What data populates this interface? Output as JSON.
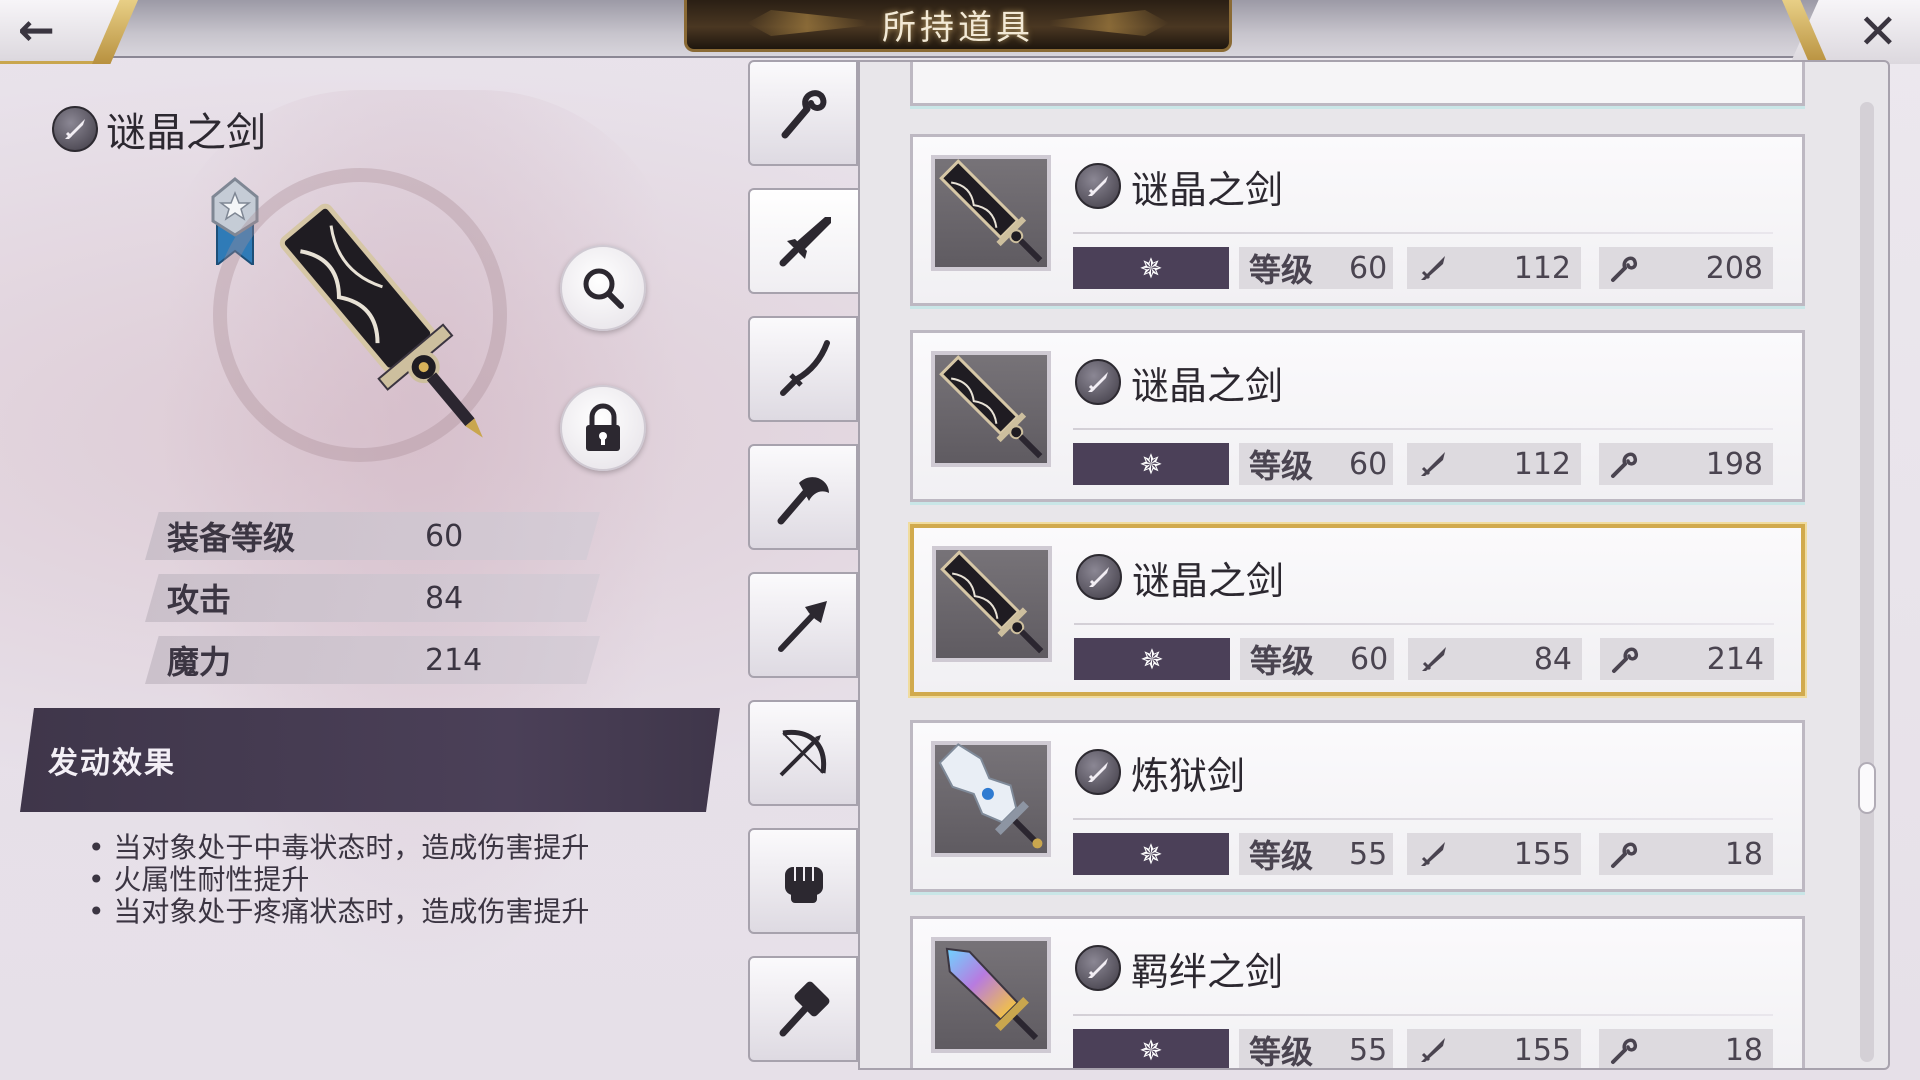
{
  "header": {
    "title": "所持道具",
    "back_icon": "back-arrow-icon",
    "close_icon": "close-icon"
  },
  "detail": {
    "name": "谜晶之剑",
    "type_icon": "sword-type-icon",
    "rank_icon": "rank-ribbon-icon",
    "zoom_icon": "magnifier-icon",
    "lock_icon": "lock-icon",
    "stats": [
      {
        "label": "装备等级",
        "value": "60"
      },
      {
        "label": "攻击",
        "value": "84"
      },
      {
        "label": "魔力",
        "value": "214"
      }
    ],
    "effect_title": "发动效果",
    "effects": [
      "当对象处于中毒状态时，造成伤害提升",
      "火属性耐性提升",
      "当对象处于疼痛状态时，造成伤害提升"
    ]
  },
  "tabs": [
    {
      "icon": "staff-icon"
    },
    {
      "icon": "sword-icon",
      "active": true
    },
    {
      "icon": "katana-icon"
    },
    {
      "icon": "axe-icon"
    },
    {
      "icon": "spear-icon"
    },
    {
      "icon": "bow-icon"
    },
    {
      "icon": "fist-icon"
    },
    {
      "icon": "hammer-icon"
    }
  ],
  "list": {
    "level_label": "等级",
    "rarity_icon": "element-star-icon",
    "attack_icon": "attack-icon",
    "magic_icon": "magic-icon",
    "items": [
      {
        "name": "谜晶之剑",
        "level": "60",
        "attack": "112",
        "magic": "208",
        "selected": false,
        "art": "crystal-sword"
      },
      {
        "name": "谜晶之剑",
        "level": "60",
        "attack": "112",
        "magic": "198",
        "selected": false,
        "art": "crystal-sword"
      },
      {
        "name": "谜晶之剑",
        "level": "60",
        "attack": "84",
        "magic": "214",
        "selected": true,
        "art": "crystal-sword"
      },
      {
        "name": "炼狱剑",
        "level": "55",
        "attack": "155",
        "magic": "18",
        "selected": false,
        "art": "inferno-sword"
      },
      {
        "name": "羁绊之剑",
        "level": "55",
        "attack": "155",
        "magic": "18",
        "selected": false,
        "art": "bond-sword"
      }
    ]
  },
  "colors": {
    "accent_dark": "#4b4058",
    "gold": "#d1aa4d",
    "card_bg": "#f6f5f7"
  }
}
